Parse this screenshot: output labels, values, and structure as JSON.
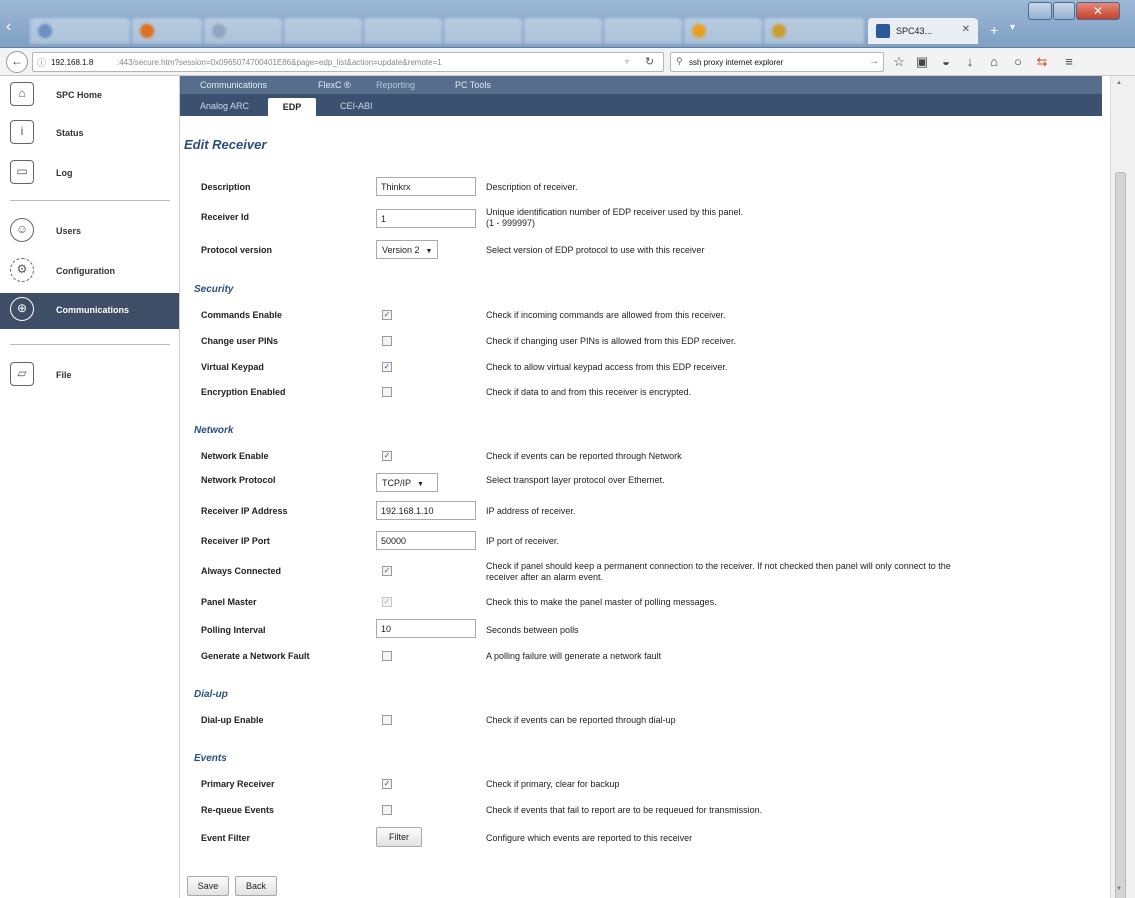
{
  "browser": {
    "active_tab_label": "SPC43...",
    "url_host": "192.168.1.8",
    "url_rest": ":443/secure.htm?session=0x0965074700401E86&page=edp_list&action=update&remote=1",
    "search_text": "ssh proxy internet explorer"
  },
  "sidebar": {
    "items": [
      {
        "label": "SPC Home",
        "icon": "house-icon"
      },
      {
        "label": "Status",
        "icon": "info-icon"
      },
      {
        "label": "Log",
        "icon": "document-icon"
      },
      {
        "label": "Users",
        "icon": "user-icon"
      },
      {
        "label": "Configuration",
        "icon": "gear-icon"
      },
      {
        "label": "Communications",
        "icon": "globe-icon"
      },
      {
        "label": "File",
        "icon": "folder-icon"
      }
    ],
    "active": "Communications"
  },
  "topnav": [
    "Communications",
    "FlexC ®",
    "Reporting",
    "PC Tools"
  ],
  "subnav": [
    "Analog ARC",
    "EDP",
    "CEI-ABI"
  ],
  "page_title": "Edit Receiver",
  "general": {
    "description": {
      "label": "Description",
      "value": "Thinkrx",
      "help": "Description of receiver."
    },
    "receiver_id": {
      "label": "Receiver Id",
      "value": "1",
      "help_line1": "Unique identification number of EDP receiver used by this panel.",
      "help_line2": "(1 - 999997)"
    },
    "protocol_version": {
      "label": "Protocol version",
      "value": "Version 2",
      "help": "Select version of EDP protocol to use with this receiver"
    }
  },
  "security": {
    "title": "Security",
    "rows": [
      {
        "label": "Commands Enable",
        "checked": true,
        "help": "Check if incoming commands are allowed from this receiver."
      },
      {
        "label": "Change user PINs",
        "checked": false,
        "help": "Check if changing user PINs is allowed from this EDP receiver."
      },
      {
        "label": "Virtual Keypad",
        "checked": true,
        "help": "Check to allow virtual keypad access from this EDP receiver."
      },
      {
        "label": "Encryption Enabled",
        "checked": false,
        "help": "Check if data to and from this receiver is encrypted."
      }
    ]
  },
  "network": {
    "title": "Network",
    "enable": {
      "label": "Network Enable",
      "checked": true,
      "help": "Check if events can be reported through Network"
    },
    "protocol": {
      "label": "Network Protocol",
      "value": "TCP/IP",
      "help": "Select transport layer protocol over Ethernet."
    },
    "ip": {
      "label": "Receiver IP Address",
      "value": "192.168.1.10",
      "help": "IP address of receiver."
    },
    "port": {
      "label": "Receiver IP Port",
      "value": "50000",
      "help": "IP port of receiver."
    },
    "always": {
      "label": "Always Connected",
      "checked": true,
      "help_line1": "Check if panel should keep a permanent connection to the receiver. If not checked then panel will only connect to the",
      "help_line2": "receiver after an alarm event."
    },
    "master": {
      "label": "Panel Master",
      "checked": true,
      "disabled": true,
      "help": "Check this to make the panel master of polling messages."
    },
    "polling": {
      "label": "Polling Interval",
      "value": "10",
      "help": "Seconds between polls"
    },
    "fault": {
      "label": "Generate a Network Fault",
      "checked": false,
      "help": "A polling failure will generate a network fault"
    }
  },
  "dialup": {
    "title": "Dial-up",
    "enable": {
      "label": "Dial-up Enable",
      "checked": false,
      "help": "Check if events can be reported through dial-up"
    }
  },
  "events": {
    "title": "Events",
    "primary": {
      "label": "Primary Receiver",
      "checked": true,
      "help": "Check if primary, clear for backup"
    },
    "requeue": {
      "label": "Re-queue Events",
      "checked": false,
      "help": "Check if events that fail to report are to be requeued for transmission."
    },
    "filter": {
      "label": "Event Filter",
      "button": "Filter",
      "help": "Configure which events are reported to this receiver"
    }
  },
  "buttons": {
    "save": "Save",
    "back": "Back"
  }
}
